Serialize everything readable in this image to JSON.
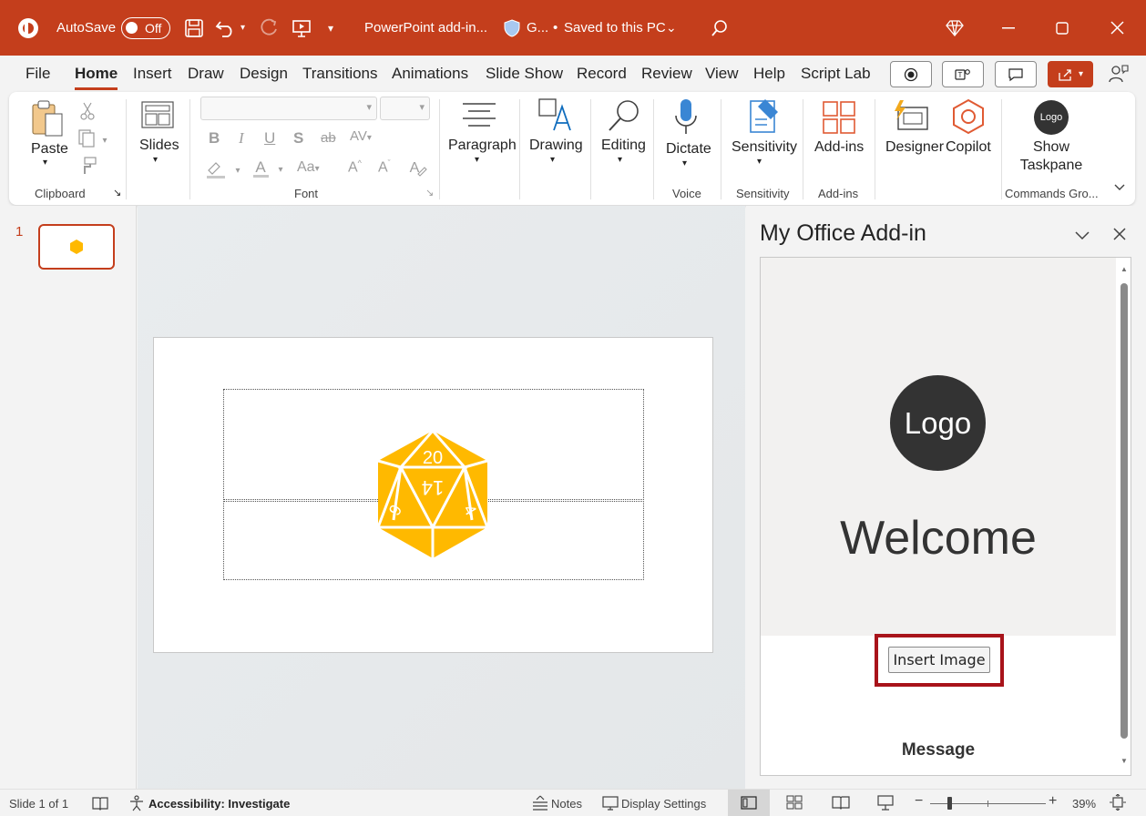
{
  "titlebar": {
    "autosave_label": "AutoSave",
    "autosave_state": "Off",
    "doc_title": "PowerPoint add-in...",
    "sensitivity_label": "G...",
    "save_status": "Saved to this PC",
    "bg_color": "#c43e1c"
  },
  "tabs": [
    "File",
    "Home",
    "Insert",
    "Draw",
    "Design",
    "Transitions",
    "Animations",
    "Slide Show",
    "Record",
    "Review",
    "View",
    "Help",
    "Script Lab"
  ],
  "active_tab": "Home",
  "ribbon": {
    "paste": "Paste",
    "clipboard": "Clipboard",
    "slides": "Slides",
    "font": "Font",
    "paragraph": "Paragraph",
    "drawing": "Drawing",
    "editing": "Editing",
    "dictate": "Dictate",
    "voice": "Voice",
    "sensitivity": "Sensitivity",
    "sensitivity_group": "Sensitivity",
    "addins": "Add-ins",
    "addins_group": "Add-ins",
    "designer": "Designer",
    "copilot": "Copilot",
    "logo_text": "Logo",
    "show": "Show",
    "taskpane": "Taskpane",
    "commands_group": "Commands Gro..."
  },
  "thumbnail_number": "1",
  "slide": {
    "d20_top": "20",
    "d20_center": "14",
    "d20_left": "9",
    "d20_right": "4",
    "d20_color": "#ffb900"
  },
  "taskpane": {
    "title": "My Office Add-in",
    "logo": "Logo",
    "welcome": "Welcome",
    "insert_image": "Insert Image",
    "message": "Message"
  },
  "status": {
    "slide_info": "Slide 1 of 1",
    "accessibility": "Accessibility: Investigate",
    "notes": "Notes",
    "display_settings": "Display Settings",
    "zoom": "39%"
  }
}
